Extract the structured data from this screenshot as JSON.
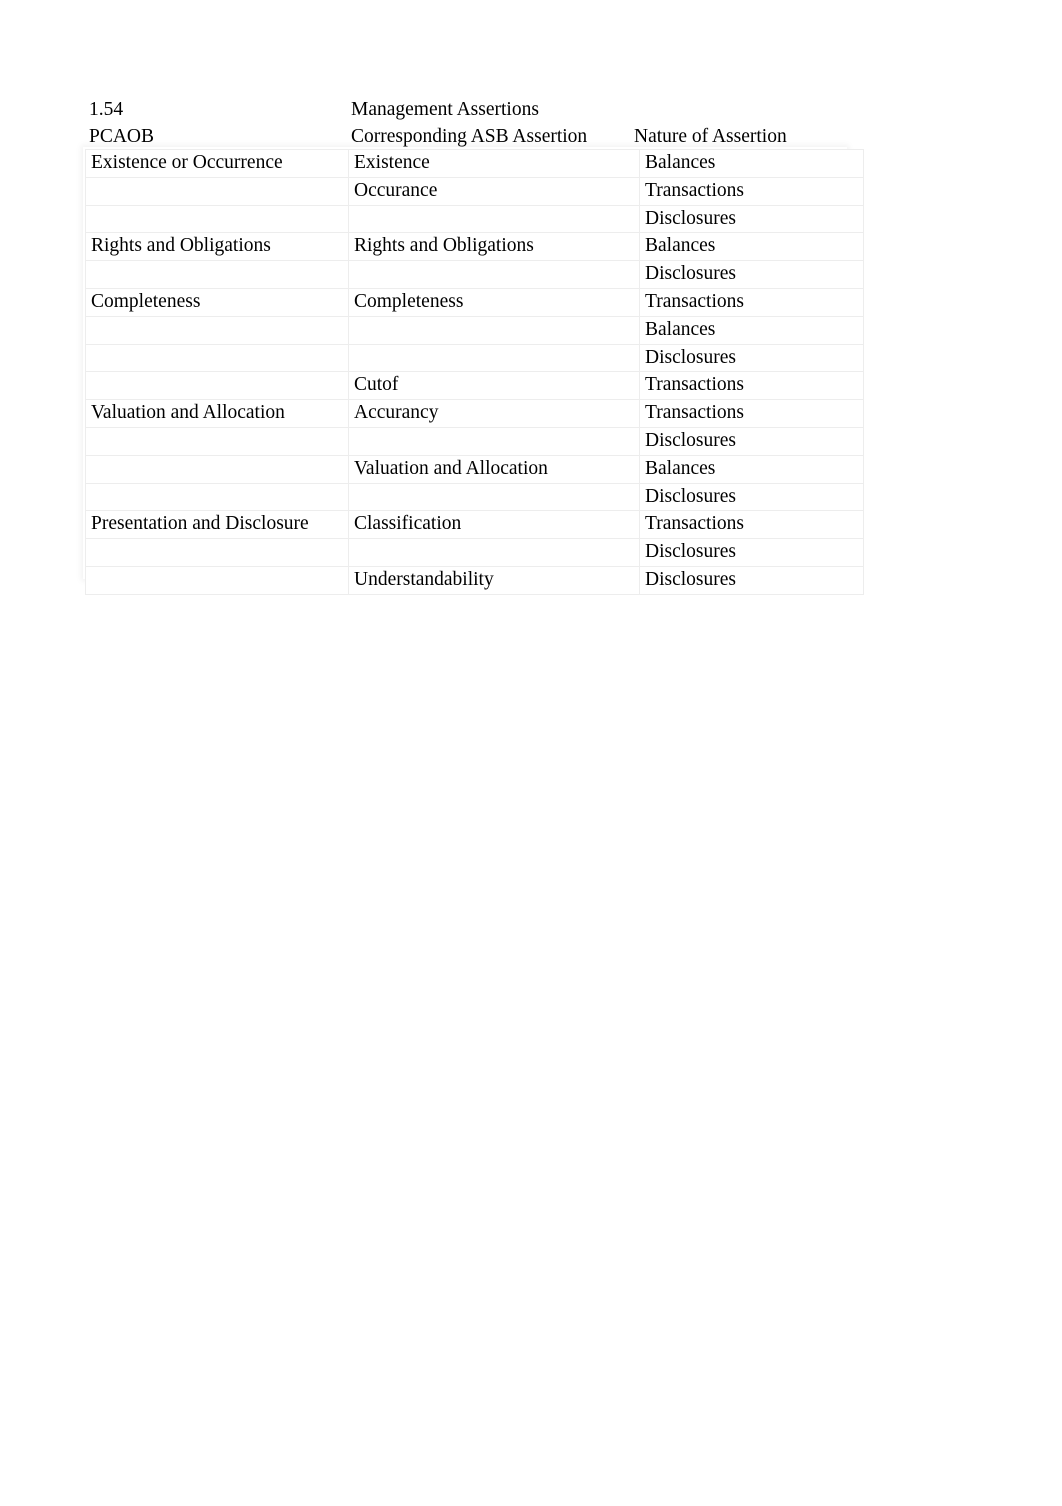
{
  "document": {
    "item_number": "1.54",
    "title": "Management Assertions"
  },
  "table": {
    "headers": {
      "col1": "PCAOB",
      "col2": "Corresponding ASB Assertion",
      "col3": "Nature of Assertion"
    },
    "rows": [
      {
        "pcaob": "Existence or Occurrence",
        "asb": "Existence",
        "nature": "Balances"
      },
      {
        "pcaob": "",
        "asb": "Occurance",
        "nature": "Transactions"
      },
      {
        "pcaob": "",
        "asb": "",
        "nature": "Disclosures"
      },
      {
        "pcaob": "Rights and Obligations",
        "asb": "Rights and Obligations",
        "nature": "Balances"
      },
      {
        "pcaob": "",
        "asb": "",
        "nature": "Disclosures"
      },
      {
        "pcaob": "Completeness",
        "asb": "Completeness",
        "nature": "Transactions"
      },
      {
        "pcaob": "",
        "asb": "",
        "nature": "Balances"
      },
      {
        "pcaob": "",
        "asb": "",
        "nature": "Disclosures"
      },
      {
        "pcaob": "",
        "asb": "Cutof",
        "nature": "Transactions"
      },
      {
        "pcaob": "Valuation and Allocation",
        "asb": "Accurancy",
        "nature": "Transactions"
      },
      {
        "pcaob": "",
        "asb": "",
        "nature": "Disclosures"
      },
      {
        "pcaob": "",
        "asb": "Valuation and Allocation",
        "nature": "Balances"
      },
      {
        "pcaob": "",
        "asb": "",
        "nature": "Disclosures"
      },
      {
        "pcaob": "Presentation and Disclosure",
        "asb": "Classification",
        "nature": "Transactions"
      },
      {
        "pcaob": "",
        "asb": "",
        "nature": "Disclosures"
      },
      {
        "pcaob": "",
        "asb": "Understandability",
        "nature": "Disclosures"
      }
    ]
  },
  "style": {
    "page_background": "#ffffff",
    "text_color": "#000000",
    "cell_border": "#ededed",
    "band_background": "#f3f3f3"
  }
}
